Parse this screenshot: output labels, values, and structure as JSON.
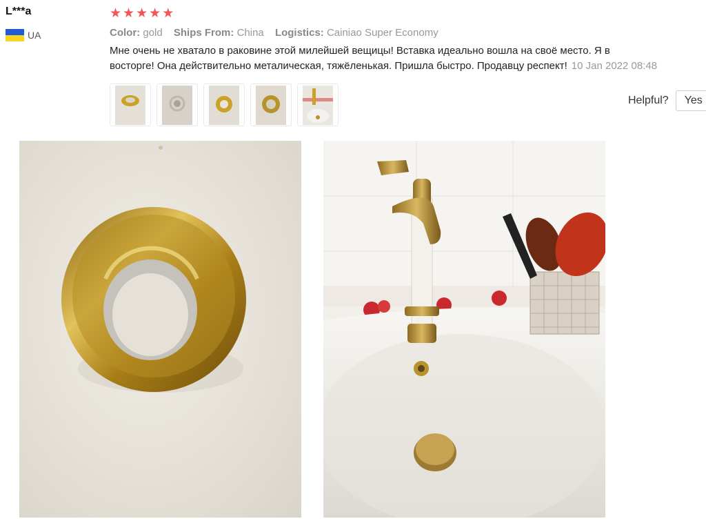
{
  "review": {
    "reviewer_name": "L***a",
    "country_code": "UA",
    "rating": 5,
    "color_key": "Color:",
    "color_value": "gold",
    "ships_from_key": "Ships From:",
    "ships_from_value": "China",
    "logistics_key": "Logistics:",
    "logistics_value": "Cainiao Super Economy",
    "text_line1": "Мне очень не хватало в раковине этой милейшей вещицы! Вставка идеально вошла на своё место. Я в",
    "text_line2": "восторге! Она действительно металическая, тяжёленькая. Пришла быстро. Продавцу респект!",
    "date": "10 Jan 2022 08:48"
  },
  "helpful": {
    "label": "Helpful?",
    "yes_label": "Yes"
  },
  "colors": {
    "star": "#f25757",
    "flag_blue": "#1f5bd6",
    "flag_yellow": "#f8d51c",
    "gold": "#c9a227"
  },
  "thumbnails": [
    "thumbnail-1",
    "thumbnail-2",
    "thumbnail-3",
    "thumbnail-4",
    "thumbnail-5"
  ]
}
